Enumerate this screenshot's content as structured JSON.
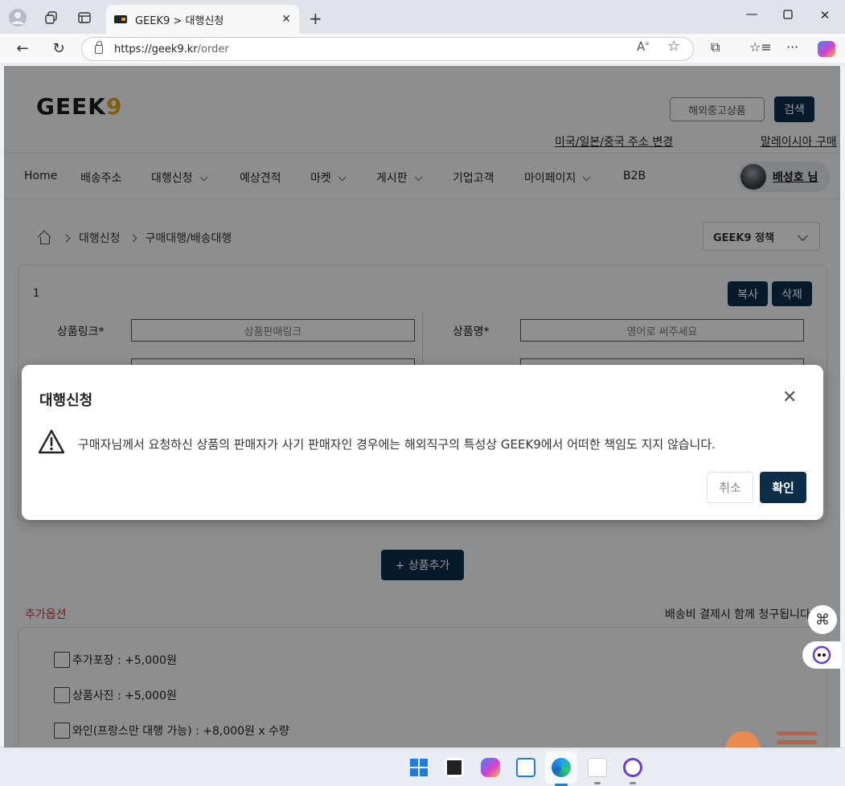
{
  "browser": {
    "tab_title": "GEEK9 > 대행신청",
    "url_host": "https://geek9.kr",
    "url_path": "/order",
    "tab_close": "✕",
    "new_tab": "+"
  },
  "header": {
    "logo_main": "GEEK",
    "logo_accent": "9",
    "search_scope": "해외중고상품",
    "search_button": "검색",
    "link_address": "미국/일본/중국 주소 변경",
    "link_malaysia": "말레이시아 구매"
  },
  "nav": {
    "items": [
      "Home",
      "배송주소",
      "대행신청",
      "예상견적",
      "마켓",
      "게시판",
      "기업고객",
      "마이페이지",
      "B2B"
    ],
    "user": "배성호 님"
  },
  "breadcrumb": {
    "level1": "대행신청",
    "level2": "구매대행/배송대행"
  },
  "policy_select": "GEEK9 정책",
  "product_card": {
    "index": "1",
    "copy_button": "복사",
    "delete_button": "삭제",
    "link_label": "상품링크*",
    "link_placeholder": "상품판매링크",
    "name_label": "상품명*",
    "name_placeholder": "영어로 써주세요"
  },
  "add_product": "+ 상품추가",
  "options": {
    "title": "추가옵션",
    "note": "배송비 결제시 함께 청구됩니다",
    "items": [
      "추가포장 : +5,000원",
      "상품사진 : +5,000원",
      "와인(프랑스만 대행 가능) : +8,000원 x 수량"
    ]
  },
  "modal": {
    "title": "대행신청",
    "message": "구매자님께서 요청하신 상품의 판매자가 사기 판매자인 경우에는 해외직구의 특성상 GEEK9에서 어떠한 책임도 지지 않습니다.",
    "cancel": "취소",
    "confirm": "확인",
    "close_glyph": "✕"
  },
  "colors": {
    "brand_dark": "#0d2e4a",
    "logo_accent": "#e0a21c",
    "option_title": "#c0392b"
  }
}
